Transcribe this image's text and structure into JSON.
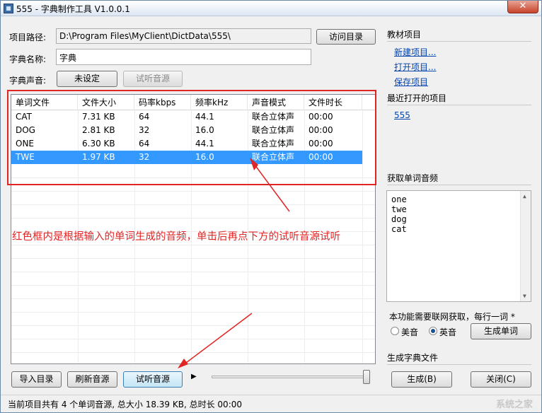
{
  "window": {
    "title": "555 - 字典制作工具 V1.0.0.1",
    "close_glyph": "✕"
  },
  "form": {
    "path_label": "项目路径:",
    "path_value": "D:\\Program Files\\MyClient\\DictData\\555\\",
    "browse_button": "访问目录",
    "name_label": "字典名称:",
    "name_value": "字典",
    "sound_label": "字典声音:",
    "sound_button": "未设定",
    "preview_source_button": "试听音源"
  },
  "table": {
    "columns": [
      "单词文件",
      "文件大小",
      "码率kbps",
      "频率kHz",
      "声音模式",
      "文件时长"
    ],
    "rows": [
      [
        "CAT",
        "7.31 KB",
        "64",
        "44.1",
        "联合立体声",
        "00:00"
      ],
      [
        "DOG",
        "2.81 KB",
        "32",
        "16.0",
        "联合立体声",
        "00:00"
      ],
      [
        "ONE",
        "6.30 KB",
        "64",
        "44.1",
        "联合立体声",
        "00:00"
      ],
      [
        "TWE",
        "1.97 KB",
        "32",
        "16.0",
        "联合立体声",
        "00:00"
      ]
    ],
    "selected_row_index": 3
  },
  "annotation": "红色框内是根据输入的单词生成的音频，单击后再点下方的试听音源试听",
  "annotation_color": "#e12424",
  "bottom_buttons": {
    "import": "导入目录",
    "refresh": "刷新音源",
    "preview": "试听音源",
    "play_glyph": "▶"
  },
  "slider": {
    "value_fraction": 1.0
  },
  "right": {
    "project_section": "教材项目",
    "new_project": "新建项目...",
    "open_project": "打开项目...",
    "save_project": "保存项目",
    "recent_section": "最近打开的项目",
    "recent_item": "555",
    "audio_section": "获取单词音频",
    "words": [
      "one",
      "twe",
      "dog",
      "cat"
    ],
    "note": "本功能需要联网获取，每行一词 *",
    "radio_us": "美音",
    "radio_uk": "英音",
    "radio_selected": "英音",
    "generate_words": "生成单词",
    "generate_section": "生成字典文件",
    "generate_button": "生成(B)",
    "close_button": "关闭(C)"
  },
  "status": {
    "text": "当前项目共有 4 个单词音源, 总大小 18.39 KB, 总时长 00:00"
  },
  "watermark": "系统之家"
}
